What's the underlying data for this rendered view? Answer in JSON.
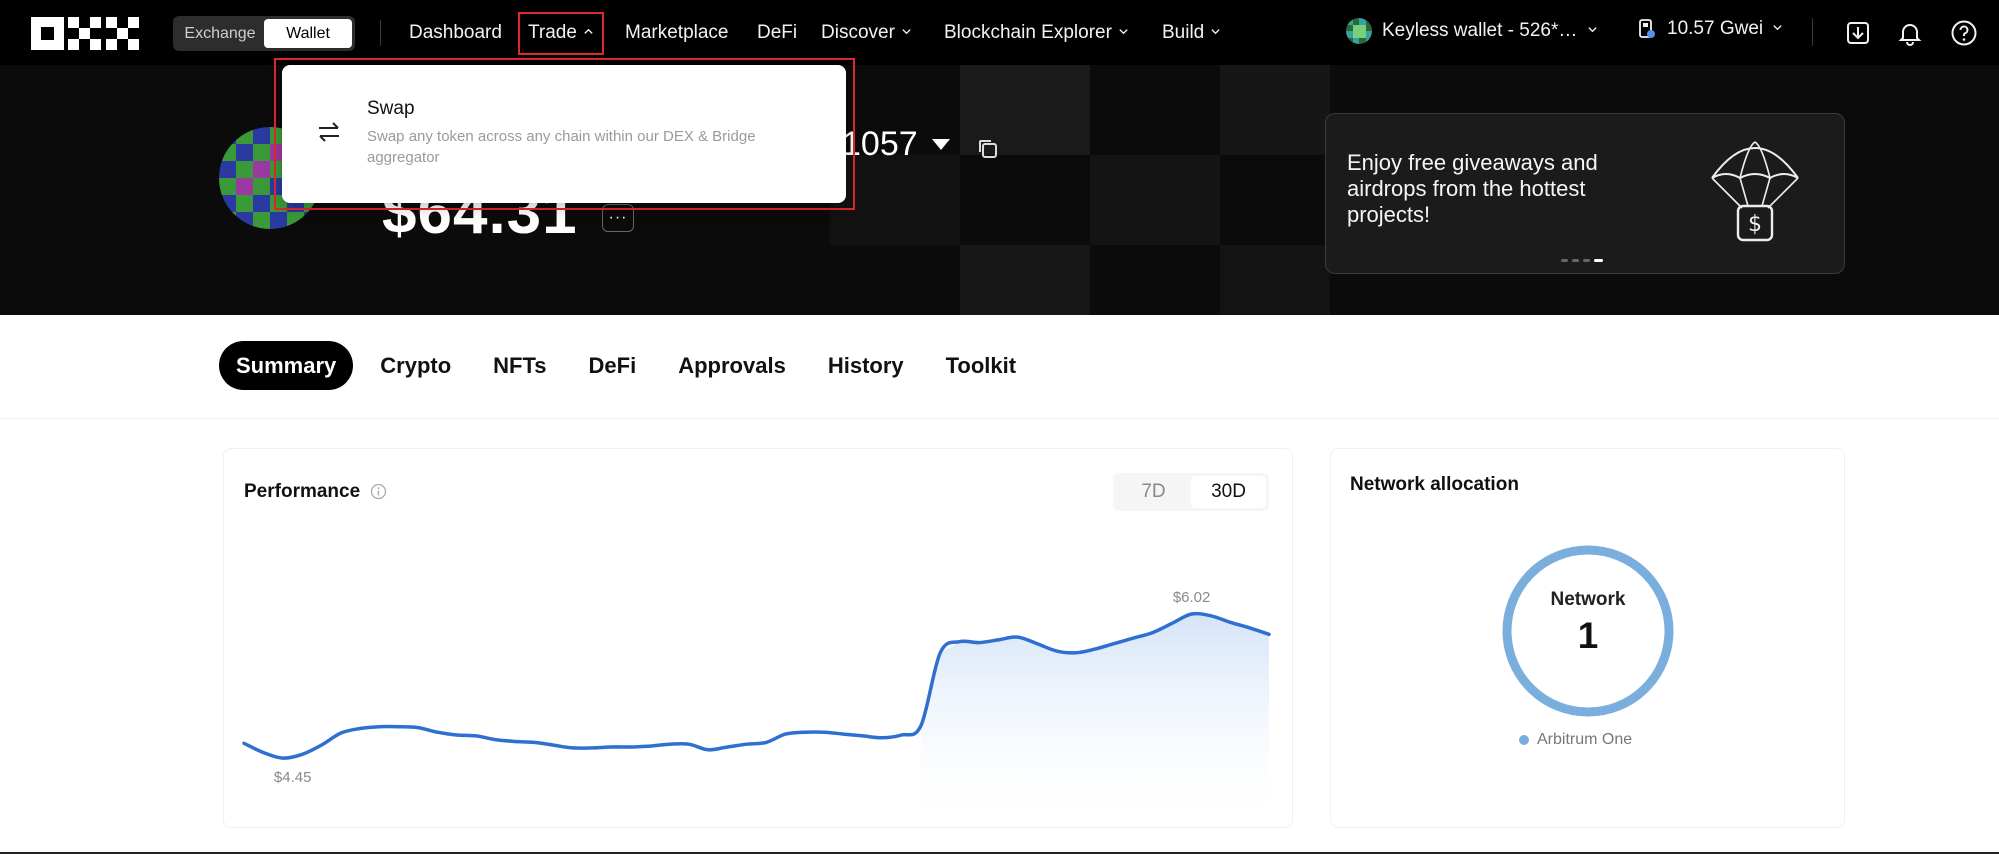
{
  "header": {
    "mode_toggle": [
      "Exchange",
      "Wallet"
    ],
    "nav": {
      "dashboard": "Dashboard",
      "trade": "Trade",
      "marketplace": "Marketplace",
      "defi": "DeFi",
      "discover": "Discover",
      "blockchain_explorer": "Blockchain Explorer",
      "build": "Build"
    },
    "wallet_account": "Keyless wallet - 526*…",
    "gas": "10.57 Gwei",
    "icons": [
      "download-icon",
      "bell-icon",
      "help-icon"
    ]
  },
  "trade_dropdown": {
    "items": [
      {
        "title": "Swap",
        "description": "Swap any token across any chain within our DEX & Bridge aggregator",
        "icon": "swap-arrows-icon"
      }
    ]
  },
  "hero": {
    "address_suffix": "1057",
    "balance": "$64.31",
    "more_label": "···",
    "promo": {
      "text": "Enjoy free giveaways and airdrops from the hottest projects!",
      "icon": "parachute-icon",
      "carousel_count": 4,
      "carousel_active": 4
    }
  },
  "tabs": [
    "Summary",
    "Crypto",
    "NFTs",
    "DeFi",
    "Approvals",
    "History",
    "Toolkit"
  ],
  "active_tab": "Summary",
  "performance": {
    "title": "Performance",
    "ranges": [
      "7D",
      "30D"
    ],
    "active_range": "30D",
    "max_label": "$6.02",
    "min_label": "$4.45"
  },
  "network_allocation": {
    "title": "Network allocation",
    "donut_label": "Network",
    "donut_value": "1",
    "legend": [
      {
        "name": "Arbitrum One",
        "color": "#7aaedc"
      }
    ]
  },
  "colors": {
    "accent_line": "#2f6fd0",
    "highlight_box": "#e0282e",
    "donut": "#7aaedc"
  },
  "chart_data": {
    "type": "area",
    "title": "Performance",
    "xlabel": "",
    "ylabel": "",
    "series": [
      {
        "values": [
          4.62,
          4.52,
          4.46,
          4.5,
          4.6,
          4.73,
          4.78,
          4.8,
          4.8,
          4.79,
          4.74,
          4.71,
          4.7,
          4.66,
          4.64,
          4.63,
          4.6,
          4.57,
          4.57,
          4.58,
          4.58,
          4.59,
          4.61,
          4.61,
          4.55,
          4.58,
          4.61,
          4.63,
          4.72,
          4.74,
          4.74,
          4.72,
          4.7,
          4.68,
          4.71,
          4.81,
          5.6,
          5.72,
          5.71,
          5.74,
          5.77,
          5.7,
          5.62,
          5.6,
          5.64,
          5.7,
          5.76,
          5.82,
          5.92,
          6.02,
          6.0,
          5.93,
          5.87,
          5.8
        ]
      }
    ],
    "ylim": [
      4.45,
      6.02
    ],
    "annotations": [
      "$6.02",
      "$4.45"
    ],
    "grid": false
  }
}
